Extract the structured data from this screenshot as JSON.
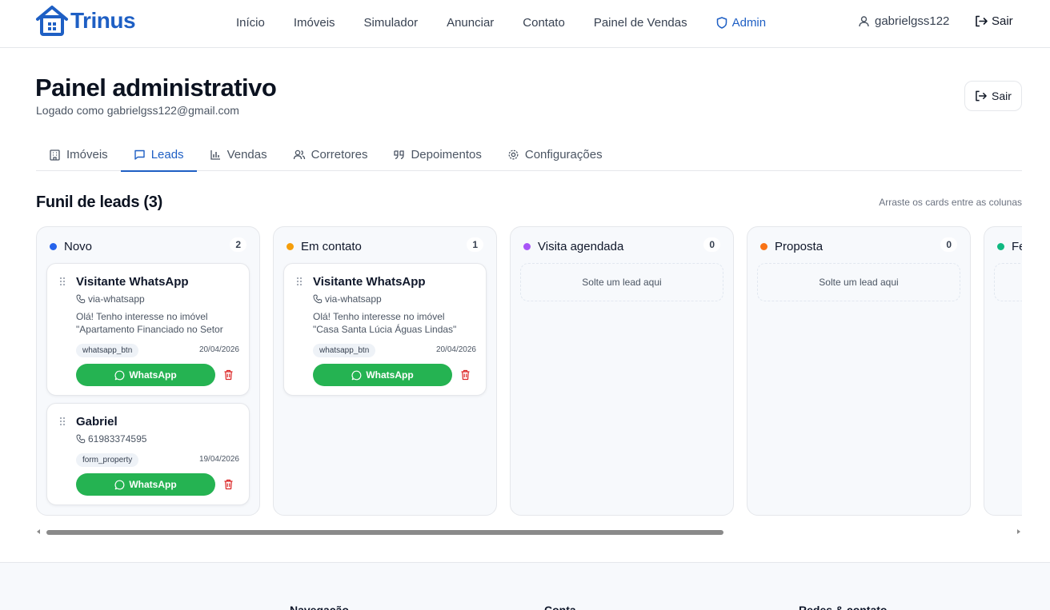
{
  "brand": {
    "name": "Trinus",
    "color": "#1e5fc4"
  },
  "nav": [
    {
      "label": "Início"
    },
    {
      "label": "Imóveis"
    },
    {
      "label": "Simulador"
    },
    {
      "label": "Anunciar"
    },
    {
      "label": "Contato"
    },
    {
      "label": "Painel de Vendas"
    },
    {
      "label": "Admin",
      "icon": "shield-icon"
    }
  ],
  "user": {
    "name": "gabrielgss122",
    "logout": "Sair"
  },
  "page": {
    "title": "Painel administrativo",
    "logged_as": "Logado como gabrielgss122@gmail.com",
    "logout_button": "Sair"
  },
  "tabs": [
    {
      "label": "Imóveis",
      "icon": "building-icon"
    },
    {
      "label": "Leads",
      "icon": "message-icon",
      "active": true
    },
    {
      "label": "Vendas",
      "icon": "bar-chart-icon"
    },
    {
      "label": "Corretores",
      "icon": "users-icon"
    },
    {
      "label": "Depoimentos",
      "icon": "quote-icon"
    },
    {
      "label": "Configurações",
      "icon": "gear-icon"
    }
  ],
  "funnel": {
    "title": "Funil de leads (3)",
    "hint": "Arraste os cards entre as colunas",
    "drop_text": "Solte um lead aqui",
    "columns": [
      {
        "name": "Novo",
        "count": "2",
        "color": "#2563eb",
        "cards": [
          {
            "name": "Visitante WhatsApp",
            "contact": "via-whatsapp",
            "message_line1": "Olá! Tenho interesse no imóvel",
            "message_line2": "\"Apartamento Financiado no Setor",
            "tag": "whatsapp_btn",
            "date": "20/04/2026",
            "button": "WhatsApp"
          },
          {
            "name": "Gabriel",
            "contact": "61983374595",
            "tag": "form_property",
            "date": "19/04/2026",
            "button": "WhatsApp"
          }
        ]
      },
      {
        "name": "Em contato",
        "count": "1",
        "color": "#f59e0b",
        "cards": [
          {
            "name": "Visitante WhatsApp",
            "contact": "via-whatsapp",
            "message_line1": "Olá! Tenho interesse no imóvel",
            "message_line2": "\"Casa Santa Lúcia Águas Lindas\"",
            "tag": "whatsapp_btn",
            "date": "20/04/2026",
            "button": "WhatsApp"
          }
        ]
      },
      {
        "name": "Visita agendada",
        "count": "0",
        "color": "#a855f7"
      },
      {
        "name": "Proposta",
        "count": "0",
        "color": "#f97316"
      },
      {
        "name": "Fe",
        "color": "#10b981"
      }
    ]
  },
  "footer": {
    "col1": "Navegação",
    "col2": "Conta",
    "col3": "Redes & contato"
  },
  "colors": {
    "whatsapp_green": "#25b352",
    "delete_red": "#dc2626"
  }
}
